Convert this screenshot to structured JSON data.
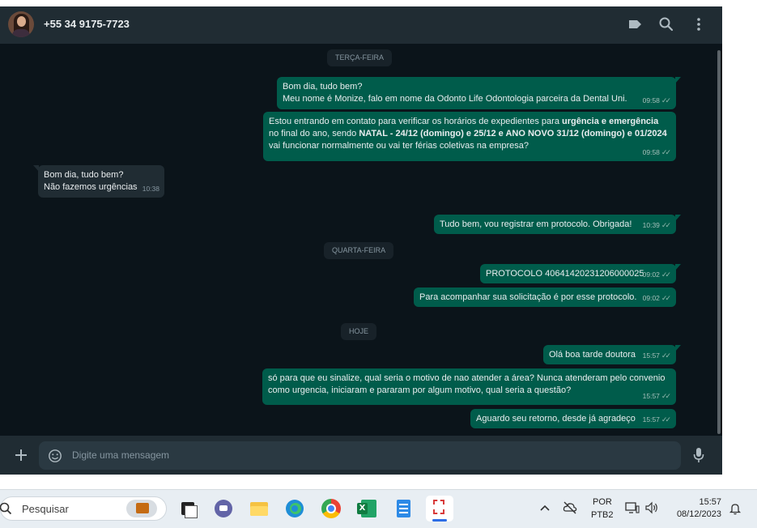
{
  "header": {
    "contact_name": "+55 34 9175-7723",
    "icons": [
      "label-icon",
      "search-icon",
      "more-vertical-icon"
    ]
  },
  "dates": {
    "d1": "TERÇA-FEIRA",
    "d2": "QUARTA-FEIRA",
    "d3": "HOJE"
  },
  "messages": {
    "m1": {
      "line1": "Bom dia, tudo bem?",
      "line2": "Meu nome é Monize, falo em nome da Odonto Life Odontologia parceira da Dental Uni.",
      "time": "09:58"
    },
    "m2": {
      "p1": "Estou entrando em contato para verificar os horários de expedientes para ",
      "b1": "urgência e emergência",
      "p2": " no final do ano, sendo ",
      "b2": "NATAL - 24/12 (domingo) e  25/12 e ANO NOVO 31/12 (domingo) e 01/2024",
      "p3": " vai funcionar normalmente ou vai ter férias coletivas na empresa?",
      "time": "09:58"
    },
    "m3": {
      "line1": "Bom dia, tudo bem?",
      "line2": "Não fazemos urgências",
      "time": "10:38"
    },
    "m4": {
      "text": "Tudo bem, vou registrar em protocolo. Obrigada!",
      "time": "10:39"
    },
    "m5": {
      "text": "PROTOCOLO 40641420231206000025",
      "time": "09:02"
    },
    "m6": {
      "text": "Para acompanhar sua solicitação é por esse protocolo.",
      "time": "09:02"
    },
    "m7": {
      "text": "Olá boa tarde doutora",
      "time": "15:57"
    },
    "m8": {
      "text": "só para que eu sinalize, qual seria o motivo de nao atender a área? Nunca atenderam pelo convenio como urgencia, iniciaram e pararam por algum motivo, qual seria a questão?",
      "time": "15:57"
    },
    "m9": {
      "text": "Aguardo seu retorno, desde já agradeço",
      "time": "15:57"
    }
  },
  "input": {
    "placeholder": "Digite uma mensagem"
  },
  "taskbar": {
    "search_label": "Pesquisar",
    "lang_top": "POR",
    "lang_bottom": "PTB2",
    "time": "15:57",
    "date": "08/12/2023"
  },
  "colors": {
    "outgoing": "#005c4b",
    "incoming": "#202c33",
    "chat_bg": "#0b141a",
    "header": "#202c33"
  }
}
